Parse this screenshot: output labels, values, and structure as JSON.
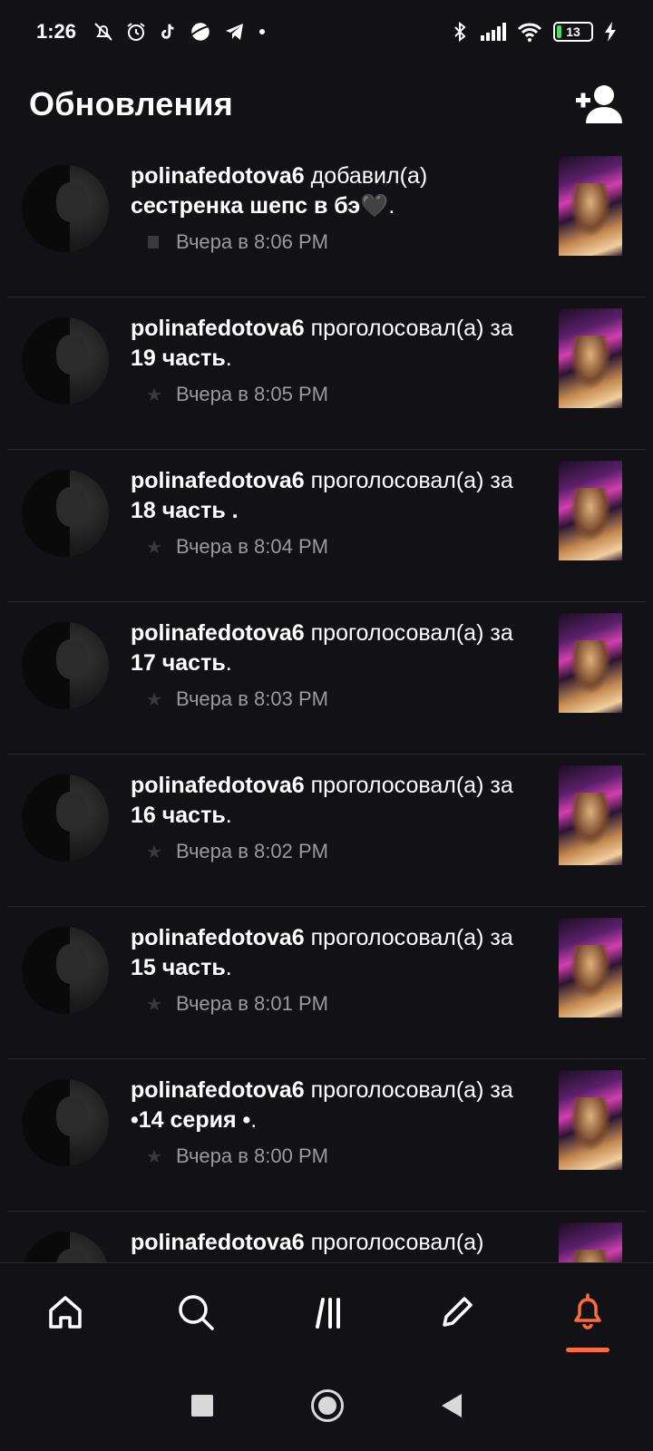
{
  "status_bar": {
    "time": "1:26",
    "battery_level": "13",
    "icons_left": [
      "bell-off-icon",
      "alarm-icon",
      "tiktok-icon",
      "planet-icon",
      "telegram-icon",
      "dot-icon"
    ],
    "icons_right": [
      "bluetooth-icon",
      "signal-icon",
      "wifi-icon",
      "battery-icon",
      "charging-icon"
    ]
  },
  "header": {
    "title": "Обновления",
    "add_friend_icon": "add-user-icon"
  },
  "feed": {
    "items": [
      {
        "user": "polinafedotova6",
        "action": "добавил(а)",
        "prefix": "",
        "target": "сестренка шепс в бэ🖤",
        "suffix": ".",
        "time": "Вчера в 8:06 PM"
      },
      {
        "user": "polinafedotova6",
        "action": "проголосовал(а)",
        "prefix": "за ",
        "target": "19 часть",
        "suffix": ".",
        "time": "Вчера в 8:05 PM"
      },
      {
        "user": "polinafedotova6",
        "action": "проголосовал(а)",
        "prefix": "за ",
        "target": "18 часть .",
        "suffix": "",
        "time": "Вчера в 8:04 PM"
      },
      {
        "user": "polinafedotova6",
        "action": "проголосовал(а)",
        "prefix": "за ",
        "target": "17 часть",
        "suffix": ".",
        "time": "Вчера в 8:03 PM"
      },
      {
        "user": "polinafedotova6",
        "action": "проголосовал(а)",
        "prefix": "за ",
        "target": "16 часть",
        "suffix": ".",
        "time": "Вчера в 8:02 PM"
      },
      {
        "user": "polinafedotova6",
        "action": "проголосовал(а)",
        "prefix": "за ",
        "target": "15 часть",
        "suffix": ".",
        "time": "Вчера в 8:01 PM"
      },
      {
        "user": "polinafedotova6",
        "action": "проголосовал(а)",
        "prefix": "за ",
        "target": "•14 серия •",
        "suffix": ".",
        "time": "Вчера в 8:00 PM"
      },
      {
        "user": "polinafedotova6",
        "action": "проголосовал(а)",
        "prefix": "",
        "target": "",
        "suffix": "",
        "time": ""
      }
    ]
  },
  "bottom_nav": {
    "items": [
      "home-icon",
      "search-icon",
      "library-icon",
      "write-icon",
      "notifications-icon"
    ],
    "active": "notifications-icon",
    "accent_color": "#ff6b3d"
  },
  "system_nav": [
    "recents-button",
    "home-button",
    "back-button"
  ]
}
